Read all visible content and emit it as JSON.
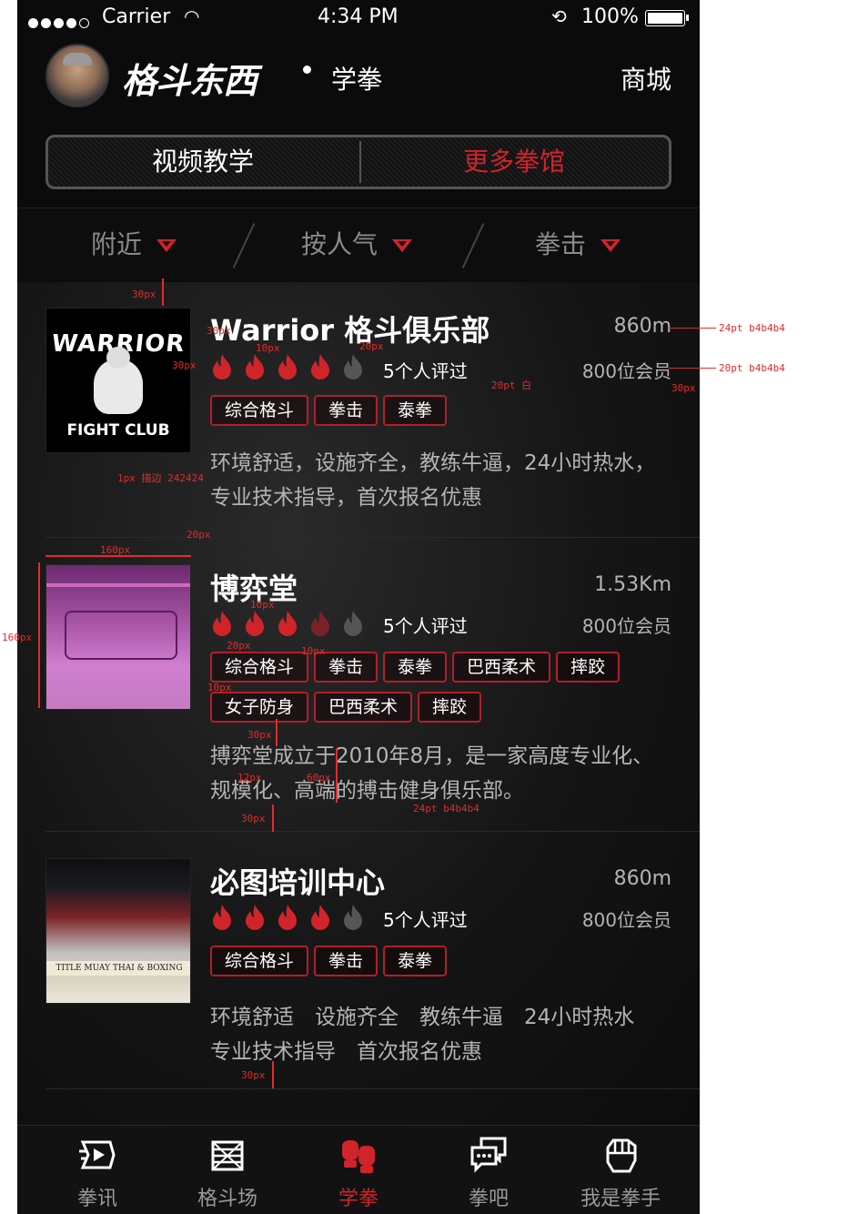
{
  "status_bar": {
    "carrier": "Carrier",
    "time": "4:34 PM",
    "battery": "100%"
  },
  "header": {
    "brand": "格斗东西",
    "section": "学拳",
    "shop": "商城"
  },
  "segmented": {
    "left": "视频教学",
    "right": "更多拳馆"
  },
  "filters": [
    {
      "label": "附近"
    },
    {
      "label": "按人气"
    },
    {
      "label": "拳击"
    }
  ],
  "gyms": [
    {
      "name": "Warrior 格斗俱乐部",
      "distance": "860m",
      "rating": 4,
      "reviews": "5个人评过",
      "members": "800位会员",
      "tags": [
        "综合格斗",
        "拳击",
        "泰拳"
      ],
      "description": "环境舒适，设施齐全，教练牛逼，24小时热水，专业技术指导，首次报名优惠",
      "thumb_lines": [
        "WARRIOR",
        "FIGHT CLUB"
      ]
    },
    {
      "name": "博弈堂",
      "distance": "1.53Km",
      "rating": 3.5,
      "reviews": "5个人评过",
      "members": "800位会员",
      "tags": [
        "综合格斗",
        "拳击",
        "泰拳",
        "巴西柔术",
        "摔跤",
        "女子防身",
        "巴西柔术",
        "摔跤"
      ],
      "description": "搏弈堂成立于2010年8月，是一家高度专业化、规模化、高端的搏击健身俱乐部。"
    },
    {
      "name": "必图培训中心",
      "distance": "860m",
      "rating": 4,
      "reviews": "5个人评过",
      "members": "800位会员",
      "tags": [
        "综合格斗",
        "拳击",
        "泰拳"
      ],
      "description": "环境舒适　设施齐全　教练牛逼　24小时热水　专业技术指导　首次报名优惠",
      "thumb_banner": "TITLE MUAY THAI & BOXING"
    }
  ],
  "tabbar": [
    {
      "label": "拳讯",
      "icon": "news-play-icon"
    },
    {
      "label": "格斗场",
      "icon": "ring-icon"
    },
    {
      "label": "学拳",
      "icon": "gloves-icon",
      "active": true
    },
    {
      "label": "拳吧",
      "icon": "chat-icon"
    },
    {
      "label": "我是拳手",
      "icon": "fist-icon"
    }
  ],
  "colors": {
    "accent": "#d0242b",
    "text_secondary": "#b4b4b4",
    "background": "#0b0b0b"
  },
  "annotations": {
    "a30": "30px",
    "a10": "10px",
    "a20": "20px",
    "a160": "160px",
    "a12": "12px",
    "a60": "60px",
    "f24": "24pt b4b4b4",
    "f20": "20pt b4b4b4",
    "f20w": "20pt 白",
    "stroke": "1px 描边 242424"
  }
}
